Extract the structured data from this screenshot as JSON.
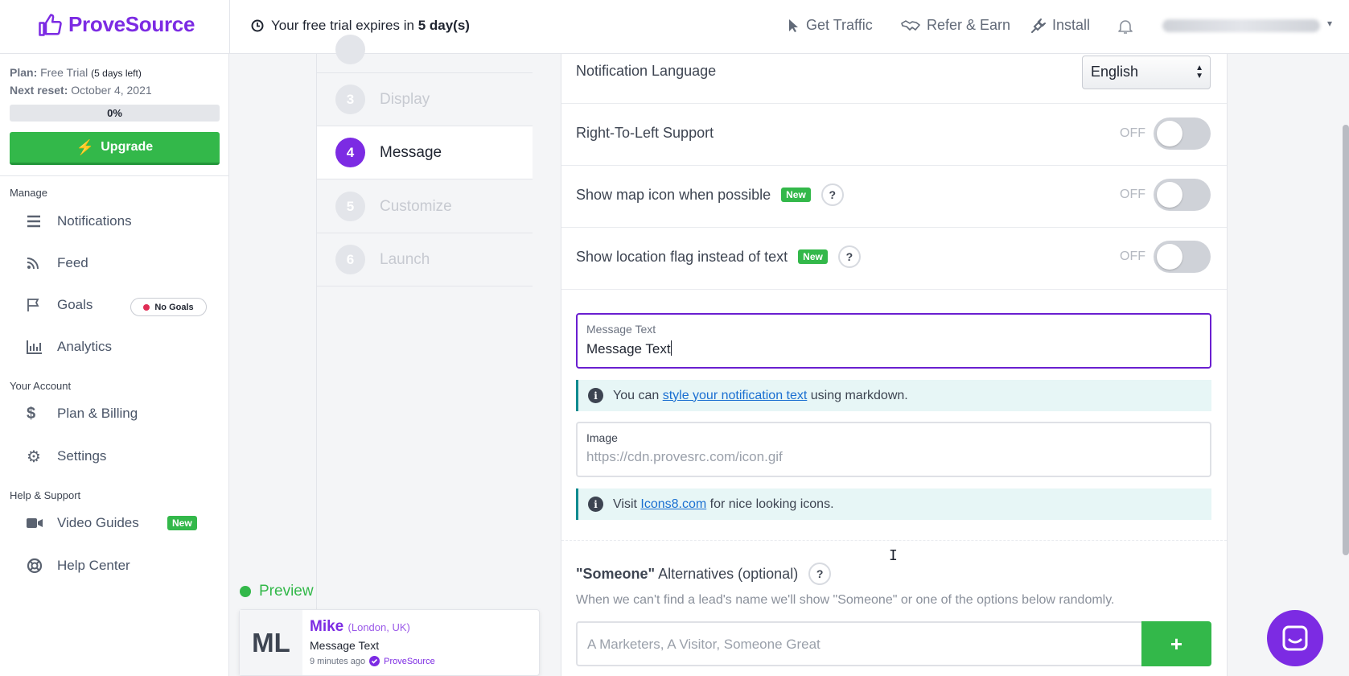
{
  "brand": {
    "name": "ProveSource",
    "color": "#7c2be3",
    "accent_green": "#33b84a"
  },
  "header": {
    "trial_prefix": "Your free trial expires in ",
    "trial_days": "5 day(s)",
    "get_traffic": "Get Traffic",
    "refer_earn": "Refer & Earn",
    "install": "Install"
  },
  "sidebar": {
    "plan_label": "Plan:",
    "plan_value": "Free Trial",
    "plan_days_left": "(5 days left)",
    "reset_label": "Next reset:",
    "reset_value": "October 4, 2021",
    "usage_progress": "0%",
    "upgrade_label": "Upgrade",
    "manage_label": "Manage",
    "account_label": "Your Account",
    "support_label": "Help & Support",
    "items": [
      {
        "label": "Notifications",
        "icon": "list-icon"
      },
      {
        "label": "Feed",
        "icon": "rss-icon"
      },
      {
        "label": "Goals",
        "icon": "flag-icon",
        "badge": "No Goals"
      },
      {
        "label": "Analytics",
        "icon": "bar-chart-icon"
      },
      {
        "label": "Plan & Billing",
        "icon": "dollar-icon"
      },
      {
        "label": "Settings",
        "icon": "gear-icon"
      },
      {
        "label": "Video Guides",
        "icon": "video-icon",
        "badge": "New"
      },
      {
        "label": "Help Center",
        "icon": "lifebuoy-icon"
      }
    ]
  },
  "steps": [
    {
      "num": "3",
      "label": "Display"
    },
    {
      "num": "4",
      "label": "Message"
    },
    {
      "num": "5",
      "label": "Customize"
    },
    {
      "num": "6",
      "label": "Launch"
    }
  ],
  "preview": {
    "label": "Preview",
    "avatar": "ML",
    "name": "Mike",
    "location": "(London, UK)",
    "message": "Message Text",
    "time": "9 minutes ago",
    "verified_by": "ProveSource"
  },
  "settings": {
    "language_label": "Notification Language",
    "language_value": "English",
    "rtl_label": "Right-To-Left Support",
    "rtl_state": "OFF",
    "map_icon_label": "Show map icon when possible",
    "map_icon_badge": "New",
    "map_icon_state": "OFF",
    "flag_label": "Show location flag instead of text",
    "flag_badge": "New",
    "flag_state": "OFF",
    "help_glyph": "?"
  },
  "message_field": {
    "label": "Message Text",
    "value": "Message Text"
  },
  "markdown_info": {
    "prefix": "You can ",
    "link": "style your notification text",
    "suffix": " using markdown."
  },
  "image_field": {
    "label": "Image",
    "placeholder": "https://cdn.provesrc.com/icon.gif"
  },
  "icons_info": {
    "prefix": "Visit ",
    "link": "Icons8.com",
    "suffix": " for nice looking icons."
  },
  "someone": {
    "title_quoted": "\"Someone\"",
    "title_rest": " Alternatives (optional)",
    "description": "When we can't find a lead's name we'll show \"Someone\" or one of the options below randomly.",
    "placeholder": "A Marketers, A Visitor, Someone Great",
    "add_label": "+"
  }
}
